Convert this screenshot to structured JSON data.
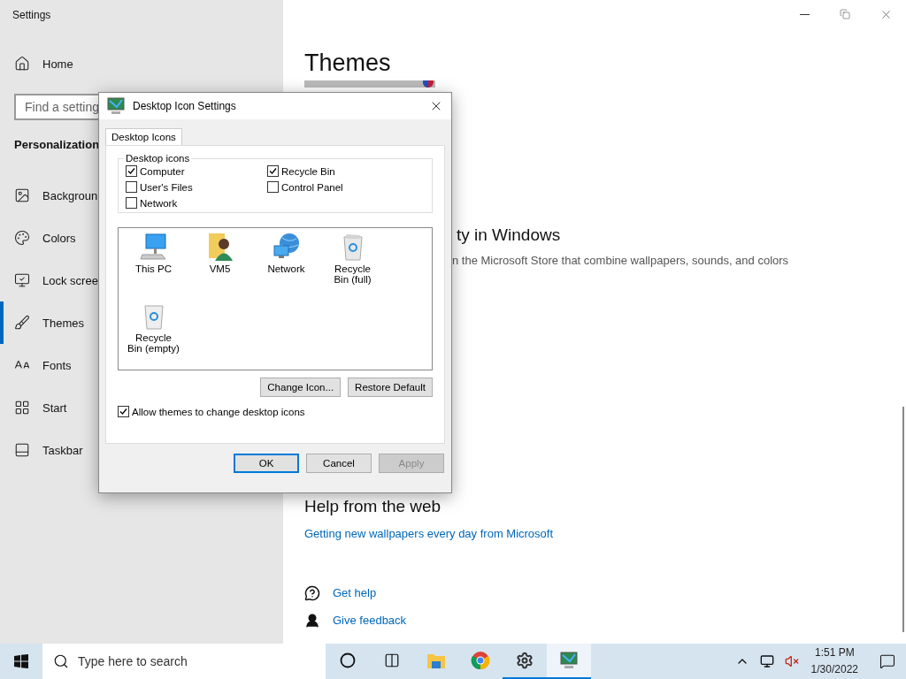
{
  "settings": {
    "title": "Settings",
    "home": "Home",
    "search": {
      "placeholder": "Find a setting"
    },
    "section": "Personalization",
    "nav": [
      {
        "kind": "background",
        "label": "Backgroun",
        "selected": false
      },
      {
        "kind": "colors",
        "label": "Colors",
        "selected": false
      },
      {
        "kind": "lock",
        "label": "Lock scree",
        "selected": false
      },
      {
        "kind": "themes",
        "label": "Themes",
        "selected": true
      },
      {
        "kind": "fonts",
        "label": "Fonts",
        "selected": false
      },
      {
        "kind": "start",
        "label": "Start",
        "selected": false
      },
      {
        "kind": "taskbar",
        "label": "Taskbar",
        "selected": false
      }
    ]
  },
  "page": {
    "title": "Themes",
    "heading": "ty in Windows",
    "description": "n the Microsoft Store that combine wallpapers, sounds, and colors",
    "help_title": "Help from the web",
    "web_link": "Getting new wallpapers every day from Microsoft",
    "links": [
      {
        "kind": "help",
        "label": "Get help"
      },
      {
        "kind": "feedback",
        "label": "Give feedback"
      }
    ]
  },
  "dialog": {
    "title": "Desktop Icon Settings",
    "tabs": [
      {
        "label": "Desktop Icons",
        "selected": true
      }
    ],
    "group_label": "Desktop icons",
    "checkboxes": [
      {
        "label": "Computer",
        "checked": true
      },
      {
        "label": "Recycle Bin",
        "checked": true
      },
      {
        "label": "User's Files",
        "checked": false
      },
      {
        "label": "Control Panel",
        "checked": false
      },
      {
        "label": "Network",
        "checked": false
      }
    ],
    "icons": [
      {
        "kind": "pc",
        "label": "This PC"
      },
      {
        "kind": "user",
        "label": "VM5"
      },
      {
        "kind": "network",
        "label": "Network"
      },
      {
        "kind": "bin-full",
        "label": "Recycle Bin (full)"
      },
      {
        "kind": "bin-empty",
        "label": "Recycle Bin (empty)"
      }
    ],
    "icon_buttons": [
      "Change Icon...",
      "Restore Default"
    ],
    "allow_themes": {
      "label": "Allow themes to change desktop icons",
      "checked": true
    },
    "buttons": [
      {
        "label": "OK",
        "default": true,
        "disabled": false
      },
      {
        "label": "Cancel",
        "default": false,
        "disabled": false
      },
      {
        "label": "Apply",
        "default": false,
        "disabled": true
      }
    ]
  },
  "taskbar": {
    "search": {
      "placeholder": "Type here to search"
    },
    "apps": [
      {
        "kind": "cortana",
        "selected": false
      },
      {
        "kind": "taskview",
        "selected": false
      },
      {
        "kind": "explorer",
        "selected": false
      },
      {
        "kind": "chrome",
        "selected": false
      },
      {
        "kind": "settings",
        "selected": false,
        "running": true
      },
      {
        "kind": "desktop-icons",
        "selected": true,
        "running": true
      }
    ],
    "time": "1:51 PM",
    "date": "1/30/2022"
  }
}
